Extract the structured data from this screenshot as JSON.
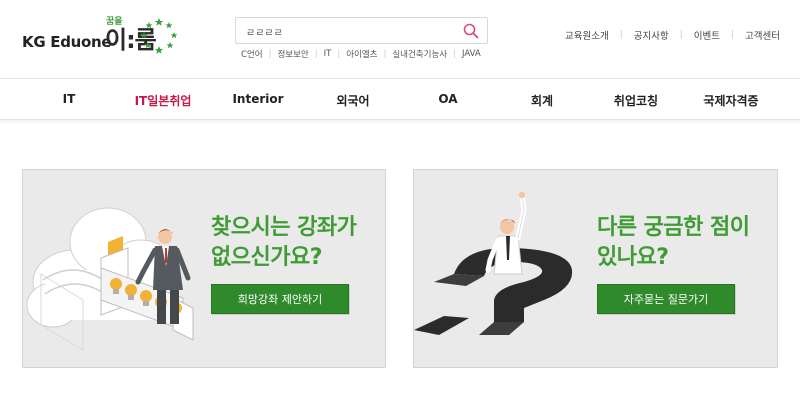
{
  "logo": {
    "brand": "KG Eduone",
    "name": "이:룸",
    "tagline": "꿈을"
  },
  "search": {
    "value": "ㄹㄹㄹㄹ",
    "keywords": [
      "C언어",
      "정보보안",
      "IT",
      "아이엘츠",
      "실내건축기능사",
      "JAVA"
    ]
  },
  "util_links": [
    "교육원소개",
    "공지사항",
    "이벤트",
    "고객센터"
  ],
  "nav": {
    "items": [
      "IT",
      "IT일본취업",
      "Interior",
      "외국어",
      "OA",
      "회계",
      "취업코칭",
      "국제자격증"
    ],
    "active_index": 1
  },
  "banners": {
    "left": {
      "title_line1": "찾으시는 강좌가",
      "title_line2": "없으신가요?",
      "button": "희망강좌 제안하기"
    },
    "right": {
      "title_line1": "다른 궁금한 점이",
      "title_line2": "있나요?",
      "button": "자주묻는 질문가기"
    }
  },
  "colors": {
    "accent_green": "#3f9c35",
    "button_green": "#2f8a2b",
    "nav_active": "#c8174b",
    "search_icon": "#e04a78"
  },
  "icons": [
    "search-icon",
    "star-wreath-icon"
  ]
}
